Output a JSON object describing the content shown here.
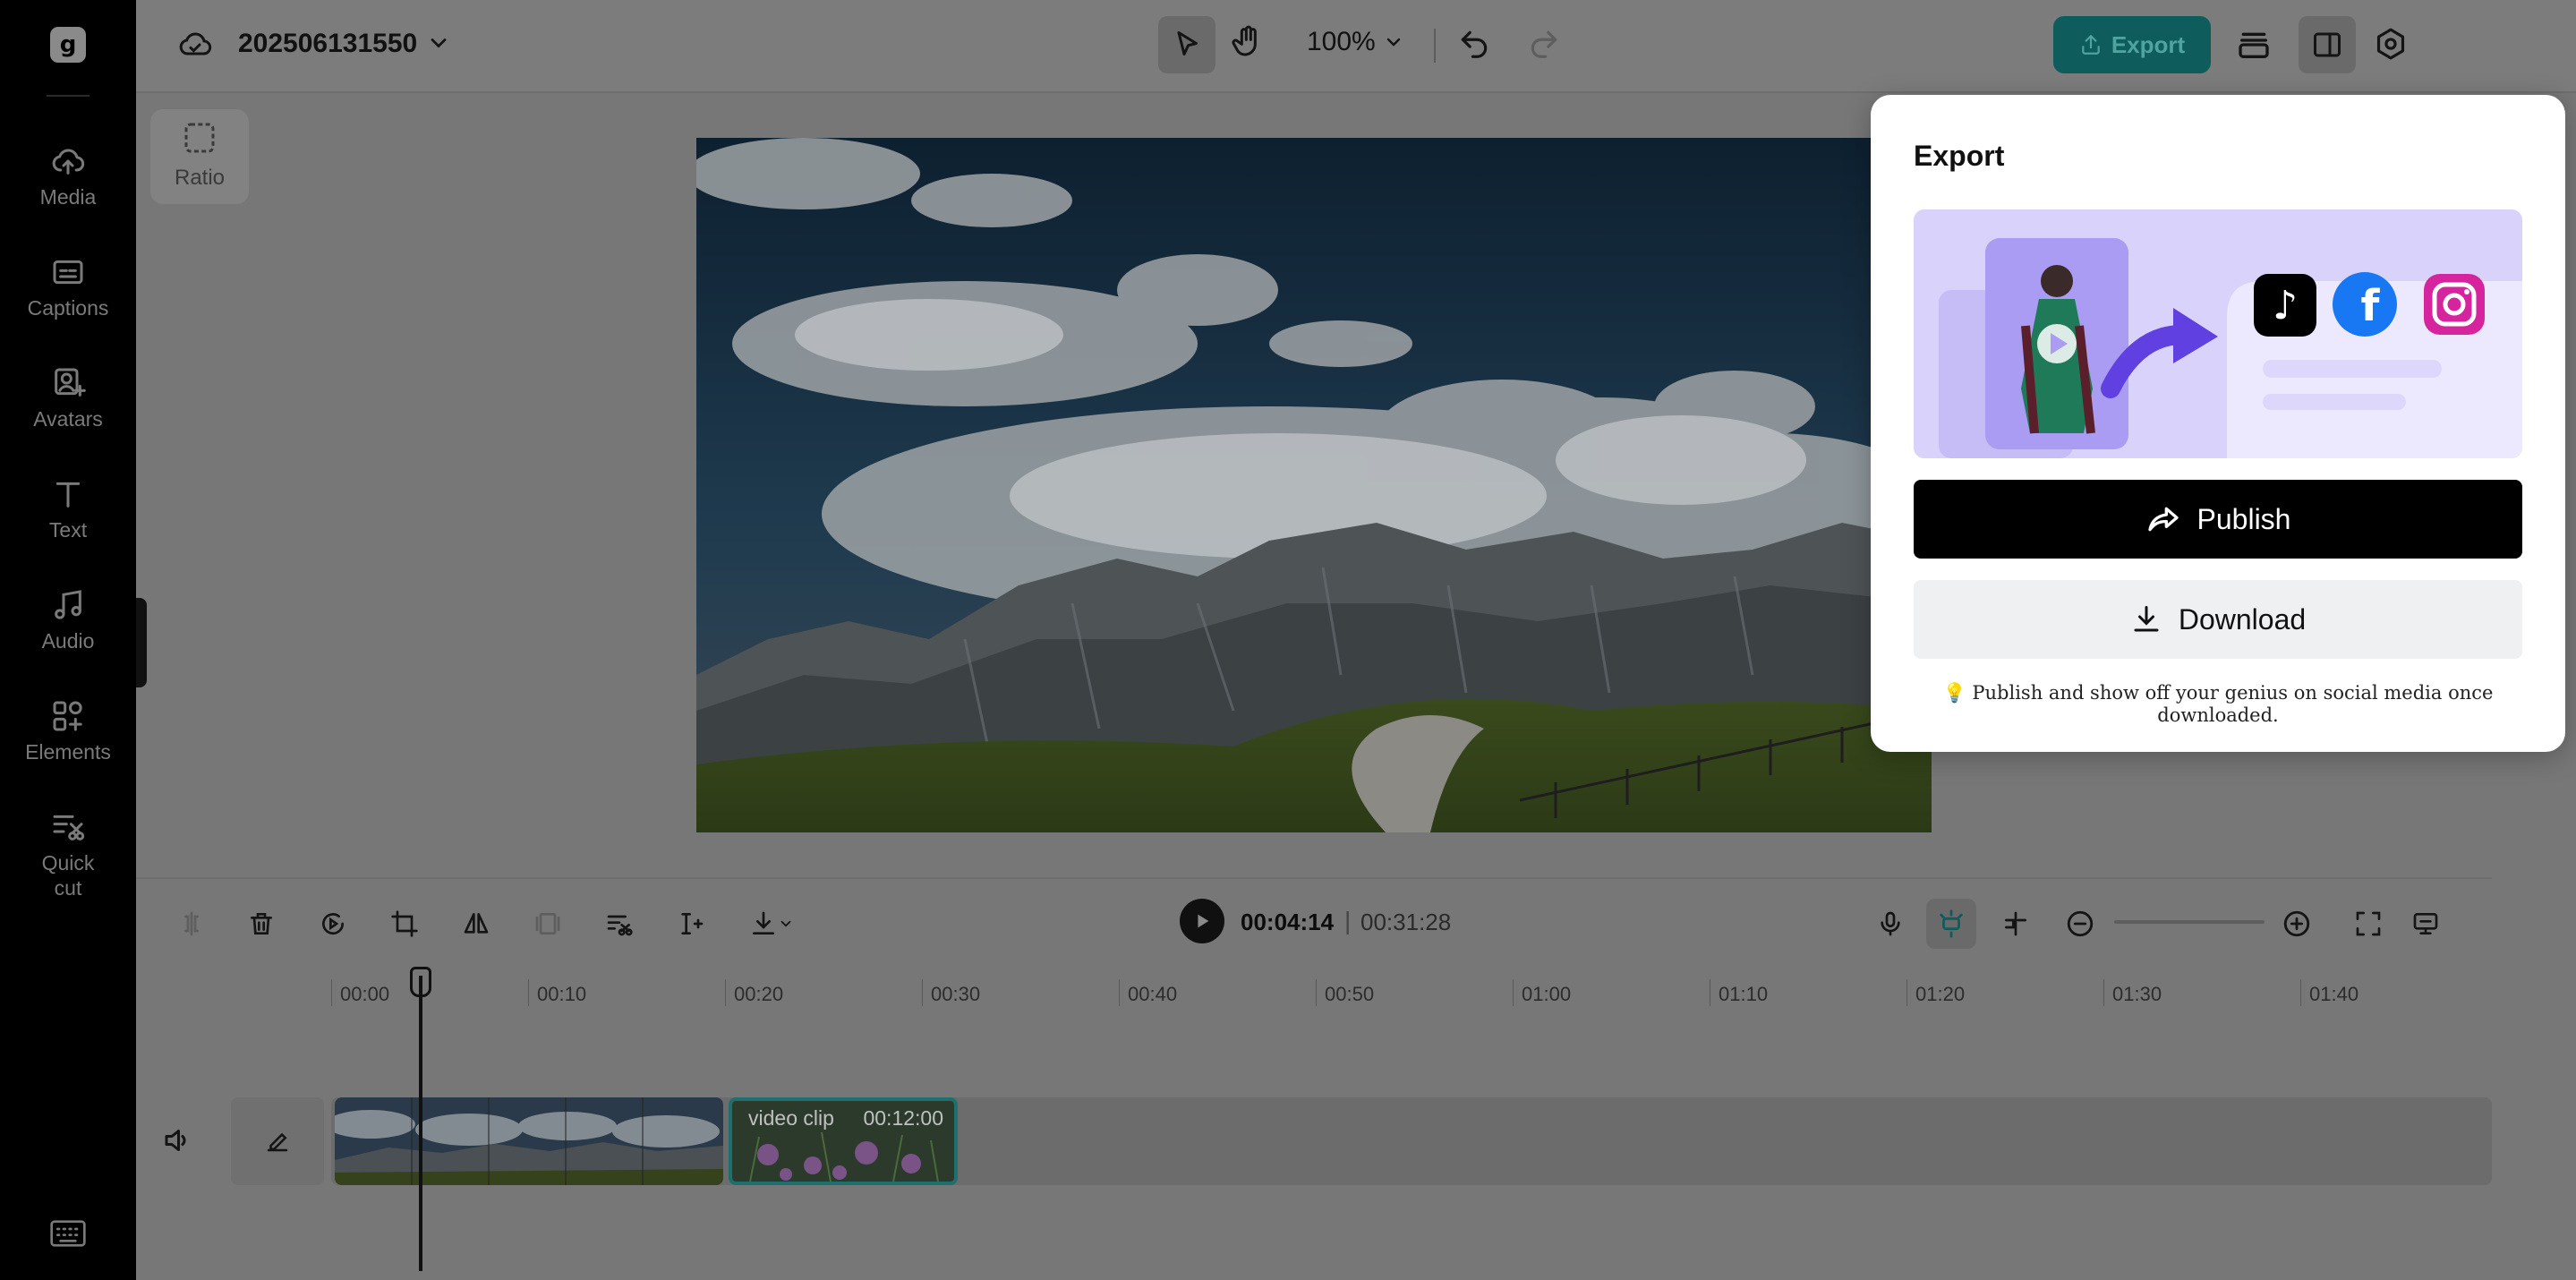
{
  "sidebar": {
    "logo": "g",
    "items": [
      {
        "label": "Media",
        "icon": "cloud-upload-icon"
      },
      {
        "label": "Captions",
        "icon": "captions-icon"
      },
      {
        "label": "Avatars",
        "icon": "avatar-icon"
      },
      {
        "label": "Text",
        "icon": "text-icon"
      },
      {
        "label": "Audio",
        "icon": "music-note-icon"
      },
      {
        "label": "Elements",
        "icon": "elements-grid-icon"
      },
      {
        "label": "Quick cut",
        "icon": "quick-cut-icon"
      }
    ],
    "bottom_icon": "keyboard-icon"
  },
  "header": {
    "project_name": "202506131550",
    "zoom": "100%",
    "export_label": "Export"
  },
  "canvas": {
    "ratio_label": "Ratio"
  },
  "playback": {
    "current_time": "00:04:14",
    "divider": "|",
    "total_time": "00:31:28"
  },
  "timeline": {
    "ticks": [
      "00:00",
      "00:10",
      "00:20",
      "00:30",
      "00:40",
      "00:50",
      "01:00",
      "01:10",
      "01:20",
      "01:30",
      "01:40"
    ],
    "clip2_label": "video clip",
    "clip2_duration": "00:12:00"
  },
  "export_panel": {
    "title": "Export",
    "publish_label": "Publish",
    "download_label": "Download",
    "tip": "💡 Publish and show off your genius on social media once downloaded."
  },
  "colors": {
    "accent": "#0f5c5c",
    "sidebar_bg": "#000000",
    "banner_bg": "#d9d3fb",
    "publish_bg": "#000000",
    "download_bg": "#eef0f2"
  }
}
